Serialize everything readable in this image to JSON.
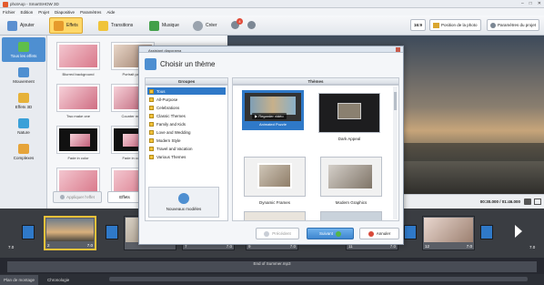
{
  "app": {
    "title": "photAop - SmartSHOW 3D"
  },
  "window_controls": [
    "–",
    "□",
    "✕"
  ],
  "menu": [
    "Fichier",
    "Edition",
    "Projet",
    "Diapositive",
    "Paramètres",
    "Aide"
  ],
  "toolbar": {
    "tabs": [
      "Ajouter",
      "Effets",
      "Transitions",
      "Musique",
      "Créer"
    ],
    "badge": "4",
    "ratio": "16:9",
    "photo_position": "Position de la photo",
    "project_settings": "Paramètres du projet"
  },
  "leftnav": [
    "Tous les effets",
    "Mouvement",
    "Effets 3D",
    "Nature",
    "Complexes"
  ],
  "effects": {
    "items": [
      "Blurred background",
      "Portrait pan r",
      "Two make one",
      "Counter move",
      "Fade in color",
      "Fade in color"
    ],
    "apply_label": "Appliquer l'effet",
    "effets_label": "Effets"
  },
  "preview": {
    "time": "00:30.000 / 01:46.000"
  },
  "timeline": {
    "slides": [
      {
        "num": "2",
        "dur": "7.0"
      },
      {
        "num": "7",
        "dur": "7.0"
      },
      {
        "num": "9",
        "dur": "7.0"
      },
      {
        "num": "11",
        "dur": "7.0"
      },
      {
        "num": "12",
        "dur": "7.0"
      }
    ],
    "edge_left": "7.0",
    "edge_right": "7.0",
    "audio_label": "End of Summer.mp3",
    "tabs": [
      "Plan de montage",
      "Chronologie"
    ]
  },
  "dialog": {
    "title": "Assistant diaporama",
    "heading": "Choisir un thème",
    "groups_header": "Groupes",
    "themes_header": "Thèmes",
    "groups": [
      "Tous",
      "All-Purpose",
      "Celebrations",
      "Classic Themes",
      "Family and Kids",
      "Love and Wedding",
      "Modern Style",
      "Travel and Vacation",
      "Various Themes"
    ],
    "new_models": "Nouveaux modèles",
    "themes": [
      {
        "label": "Animated Puzzle",
        "watch": "Regarder vidéo"
      },
      {
        "label": "Dark Appeal"
      },
      {
        "label": "Dynamic Frames"
      },
      {
        "label": "Modern Graphics"
      }
    ],
    "buttons": {
      "prev": "Précédent",
      "next": "Suivant",
      "cancel": "Annuler"
    }
  }
}
